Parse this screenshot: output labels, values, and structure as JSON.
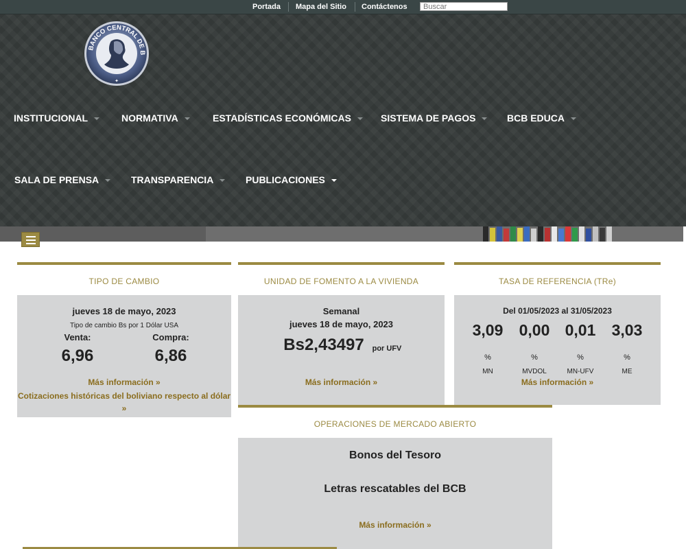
{
  "topbar": {
    "links": [
      "Portada",
      "Mapa del Sitio",
      "Contáctenos"
    ],
    "search_placeholder": "Buscar"
  },
  "nav": {
    "row1": [
      "INSTITUCIONAL",
      "NORMATIVA",
      "ESTADÍSTICAS ECONÓMICAS",
      "SISTEMA DE PAGOS",
      "BCB EDUCA"
    ],
    "row2": [
      "SALA DE PRENSA",
      "TRANSPARENCIA",
      "PUBLICACIONES"
    ]
  },
  "logo": {
    "text": "BANCO CENTRAL DE BOLIVIA"
  },
  "tipo_cambio": {
    "title": "TIPO DE CAMBIO",
    "date": "jueves 18 de mayo, 2023",
    "subtitle": "Tipo de cambio Bs por 1 Dólar USA",
    "venta_label": "Venta:",
    "compra_label": "Compra:",
    "venta_value": "6,96",
    "compra_value": "6,86",
    "more": "Más información »",
    "historicas_line1": "Cotizaciones históricas del boliviano respecto al dólar",
    "historicas_line2": "»"
  },
  "ufv": {
    "title": "UNIDAD DE FOMENTO A LA VIVIENDA",
    "period": "Semanal",
    "date": "jueves 18 de mayo, 2023",
    "value": "Bs2,43497",
    "unit": "por UFV",
    "more": "Más información »"
  },
  "tre": {
    "title": "TASA DE REFERENCIA (TRe)",
    "range": "Del 01/05/2023 al 31/05/2023",
    "rates": [
      {
        "value": "3,09",
        "pct": "%",
        "label": "MN"
      },
      {
        "value": "0,00",
        "pct": "%",
        "label": "MVDOL"
      },
      {
        "value": "0,01",
        "pct": "%",
        "label": "MN-UFV"
      },
      {
        "value": "3,03",
        "pct": "%",
        "label": "ME"
      }
    ],
    "more": "Más información »"
  },
  "oma": {
    "title": "OPERACIONES DE MERCADO ABIERTO",
    "item1": "Bonos del Tesoro",
    "item2": "Letras rescatables del BCB",
    "more": "Más información »"
  },
  "colors": {
    "gold": "#9b8a42",
    "header_bg": "#363b3a",
    "panel_bg": "#d4d5d6",
    "link": "#8a6d1e"
  }
}
